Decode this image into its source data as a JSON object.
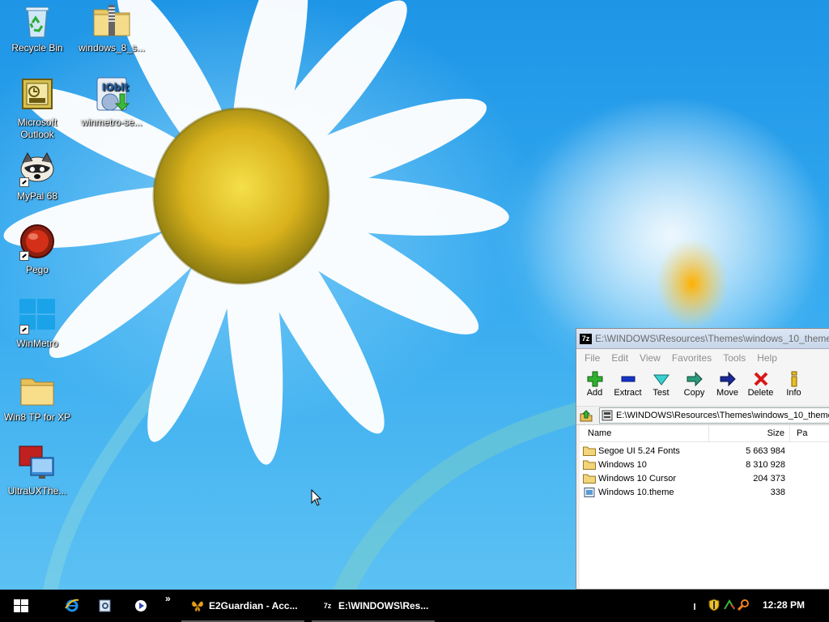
{
  "desktop": {
    "icons": [
      {
        "label": "Recycle Bin",
        "icon": "recycle-bin-icon"
      },
      {
        "label": "windows_8_s...",
        "icon": "zip-folder-icon"
      },
      {
        "label": "Microsoft\nOutlook",
        "icon": "outlook-icon"
      },
      {
        "label": "winmetro-se...",
        "icon": "iobit-installer-icon"
      },
      {
        "label": "MyPal 68",
        "icon": "raccoon-icon"
      },
      {
        "label": "Pego",
        "icon": "pego-icon"
      },
      {
        "label": "WinMetro",
        "icon": "windows-logo-icon"
      },
      {
        "label": "Win8 TP for XP",
        "icon": "folder-icon"
      },
      {
        "label": "UltraUXThe...",
        "icon": "ultraux-icon"
      }
    ]
  },
  "sevenzip": {
    "title": "E:\\WINDOWS\\Resources\\Themes\\windows_10_theme",
    "app_badge": "7z",
    "menu": [
      "File",
      "Edit",
      "View",
      "Favorites",
      "Tools",
      "Help"
    ],
    "toolbar": [
      {
        "label": "Add",
        "icon": "add-icon"
      },
      {
        "label": "Extract",
        "icon": "extract-icon"
      },
      {
        "label": "Test",
        "icon": "test-icon"
      },
      {
        "label": "Copy",
        "icon": "copy-icon"
      },
      {
        "label": "Move",
        "icon": "move-icon"
      },
      {
        "label": "Delete",
        "icon": "delete-icon"
      },
      {
        "label": "Info",
        "icon": "info-icon"
      }
    ],
    "address": "E:\\WINDOWS\\Resources\\Themes\\windows_10_theme",
    "columns": {
      "name": "Name",
      "size": "Size",
      "packed": "Pa"
    },
    "files": [
      {
        "name": "Segoe UI 5.24 Fonts",
        "size": "5 663 984",
        "type": "folder"
      },
      {
        "name": "Windows 10",
        "size": "8 310 928",
        "type": "folder"
      },
      {
        "name": "Windows 10 Cursor",
        "size": "204 373",
        "type": "folder"
      },
      {
        "name": "Windows 10.theme",
        "size": "338",
        "type": "theme-file"
      }
    ]
  },
  "taskbar": {
    "tasks": [
      {
        "label": "E2Guardian - Acc...",
        "icon": "butterfly-icon"
      },
      {
        "label": "E:\\WINDOWS\\Res...",
        "icon": "sevenzip-icon"
      }
    ],
    "overflow": "»",
    "clock": "12:28 PM"
  }
}
